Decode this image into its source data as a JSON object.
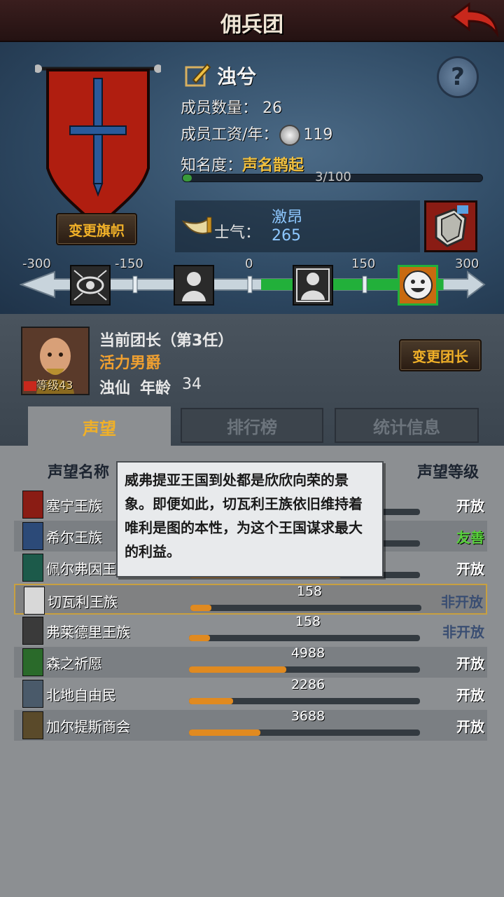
{
  "header": {
    "title": "佣兵团"
  },
  "company": {
    "name": "浊兮",
    "members_label": "成员数量：",
    "members_value": "26",
    "wage_label": "成员工资/年：",
    "wage_value": "119",
    "fame_label": "知名度：",
    "fame_value": "声名鹊起",
    "fame_progress_text": "3/100",
    "fame_progress": 0.03,
    "change_banner_label": "变更旗帜",
    "help_label": "?"
  },
  "morale": {
    "label": "士气：",
    "state": "激昂",
    "value": "265",
    "scale_labels": [
      "-300",
      "-150",
      "0",
      "150",
      "300"
    ],
    "scale_value": 265,
    "scale_range": [
      -300,
      300
    ]
  },
  "leader": {
    "title": "当前团长（第3任）",
    "class": "活力男爵",
    "name": "浊仙",
    "age_label": "年龄",
    "age": "34",
    "level_label": "等级43",
    "change_label": "变更团长"
  },
  "tabs": [
    {
      "label": "声望",
      "active": true
    },
    {
      "label": "排行榜",
      "active": false
    },
    {
      "label": "统计信息",
      "active": false
    }
  ],
  "columns": {
    "name": "声望名称",
    "level": "声望等级"
  },
  "factions": [
    {
      "name": "塞宁王族",
      "value": "",
      "fill": 0.35,
      "status": "开放",
      "status_type": "open",
      "color": "#8a1c14"
    },
    {
      "name": "希尔王族",
      "value": "",
      "fill": 0.3,
      "status": "友善",
      "status_type": "friendly",
      "color": "#2c4a78"
    },
    {
      "name": "佩尔弗因王",
      "value": "",
      "fill": 0.66,
      "status": "开放",
      "status_type": "open",
      "color": "#1c5a4a"
    },
    {
      "name": "切瓦利王族",
      "value": "158",
      "fill": 0.09,
      "status": "非开放",
      "status_type": "closed",
      "color": "#d8d8d8"
    },
    {
      "name": "弗莱德里王族",
      "value": "158",
      "fill": 0.09,
      "status": "非开放",
      "status_type": "closed",
      "color": "#3a3a3a"
    },
    {
      "name": "森之祈愿",
      "value": "4988",
      "fill": 0.42,
      "status": "开放",
      "status_type": "open",
      "color": "#2a6a2a"
    },
    {
      "name": "北地自由民",
      "value": "2286",
      "fill": 0.19,
      "status": "开放",
      "status_type": "open",
      "color": "#4a5a6a"
    },
    {
      "name": "加尔提斯商会",
      "value": "3688",
      "fill": 0.31,
      "status": "开放",
      "status_type": "open",
      "color": "#5a4a2a"
    }
  ],
  "tooltip": {
    "text": "威弗提亚王国到处都是欣欣向荣的景象。即便如此，切瓦利王族依旧维持着唯利是图的本性，为这个王国谋求最大的利益。"
  }
}
